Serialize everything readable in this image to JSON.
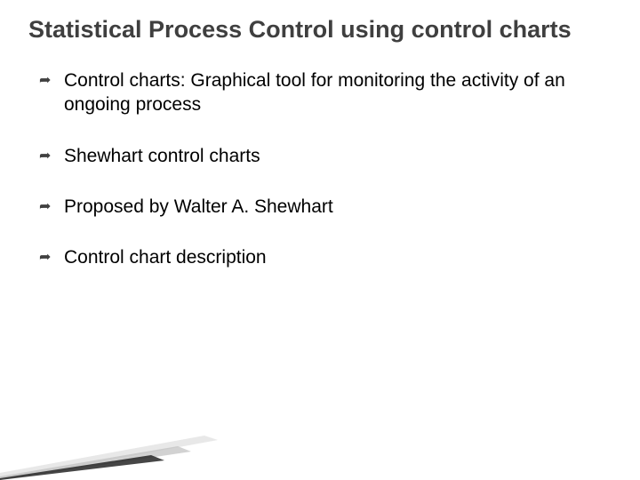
{
  "title": "Statistical Process Control using control charts",
  "bullets": [
    "Control charts: Graphical tool for monitoring the activity of an ongoing process",
    "Shewhart control charts",
    "Proposed by Walter A. Shewhart",
    "Control chart description"
  ]
}
